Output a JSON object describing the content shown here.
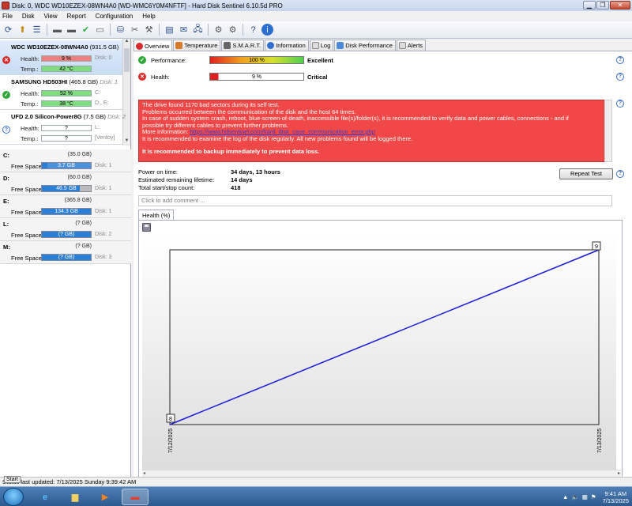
{
  "window": {
    "title": "Disk: 0, WDC WD10EZEX-08WN4A0 [WD-WMC6Y0M4NFTF]  -  Hard Disk Sentinel 6.10.5d PRO"
  },
  "menu": [
    "File",
    "Disk",
    "View",
    "Report",
    "Configuration",
    "Help"
  ],
  "toolbar_icons": [
    "refresh-icon",
    "disk-info-icon",
    "menu-icon",
    "disk-icon",
    "disk-check-icon",
    "disk-ok-icon",
    "disk-test-icon",
    "network-icon",
    "scissors-icon",
    "wrench-icon",
    "report-icon",
    "mail-icon",
    "monitor-icon",
    "gear-icon",
    "settings-icon",
    "help-icon",
    "info-icon"
  ],
  "disks": [
    {
      "name": "WDC WD10EZEX-08WN4A0",
      "size": "(931.5 GB)",
      "health_label": "Health:",
      "health": "9 %",
      "health_color": "#f08080",
      "disk_no": "Disk: 0",
      "temp_label": "Temp.:",
      "temp": "42 °C",
      "temp_color": "#7fdc7f",
      "status": "bad",
      "vols": ""
    },
    {
      "name": "SAMSUNG HD503HI",
      "size": "(465.8 GB)",
      "health_label": "Health:",
      "health": "52 %",
      "health_color": "#7fdc7f",
      "disk_no": "Disk: 1",
      "temp_label": "Temp.:",
      "temp": "38 °C",
      "temp_color": "#7fdc7f",
      "status": "good",
      "vols": "C:",
      "vols2": "D:, E:"
    },
    {
      "name": "UFD 2.0 Silicon-Power8G",
      "size": "(7.5 GB)",
      "health_label": "Health:",
      "health": "?",
      "health_color": "#ffffff",
      "disk_no": "Disk: 2",
      "temp_label": "Temp.:",
      "temp": "?",
      "temp_color": "#ffffff",
      "status": "unk",
      "vols": "L:",
      "vols2": "[Ventoy]"
    }
  ],
  "volumes": [
    {
      "letter": "C:",
      "size": "(35.0 GB)",
      "free_label": "Free Space",
      "free": "3.7 GB",
      "fill_pct": 11,
      "disk": "Disk: 1"
    },
    {
      "letter": "D:",
      "size": "(60.0 GB)",
      "free_label": "Free Space",
      "free": "46.5 GB",
      "fill_pct": 77,
      "disk": "Disk: 1"
    },
    {
      "letter": "E:",
      "size": "(365.8 GB)",
      "free_label": "Free Space",
      "free": "134.3 GB",
      "fill_pct": 37,
      "disk": "Disk: 1"
    },
    {
      "letter": "L:",
      "size": "(? GB)",
      "free_label": "Free Space",
      "free": "(? GB)",
      "fill_pct": 100,
      "disk": "Disk: 2"
    },
    {
      "letter": "M:",
      "size": "(? GB)",
      "free_label": "Free Space",
      "free": "(? GB)",
      "fill_pct": 100,
      "disk": "Disk: 3"
    }
  ],
  "tabs": [
    "Overview",
    "Temperature",
    "S.M.A.R.T.",
    "Information",
    "Log",
    "Disk Performance",
    "Alerts"
  ],
  "overview": {
    "performance_label": "Performance:",
    "performance_value": "100 %",
    "performance_pct": 100,
    "performance_verdict": "Excellent",
    "health_label": "Health:",
    "health_value": "9 %",
    "health_pct": 9,
    "health_verdict": "Critical",
    "message_lines": [
      "The drive found 1170 bad sectors during its self test.",
      "Problems occurred between the communication of the disk and the host 64 times.",
      "In case of sudden system crash, reboot, blue-screen-of-death, inaccessible file(s)/folder(s), it is recommended to verify data and power cables, connections - and if",
      "possible try different cables to prevent further problems."
    ],
    "more_info_label": "More information:",
    "more_info_link": "https://www.hdsentinel.com/hard_disk_case_communication_error.php",
    "log_line": "It is recommended to examine the log of the disk regularly. All new problems found will be logged there.",
    "backup_line": "It is recommended to backup immediately to prevent data loss.",
    "power_on_label": "Power on time:",
    "power_on_value": "34 days, 13 hours",
    "lifetime_label": "Estimated remaining lifetime:",
    "lifetime_value": "14 days",
    "startstop_label": "Total start/stop count:",
    "startstop_value": "418",
    "repeat_button": "Repeat Test",
    "comment_placeholder": "Click to add comment ...",
    "chart_tab": "Health (%)"
  },
  "chart_data": {
    "type": "line",
    "x": [
      "7/12/2025",
      "7/13/2025"
    ],
    "series": [
      {
        "values": [
          8,
          9
        ]
      }
    ],
    "data_labels": [
      "8",
      "9"
    ],
    "series_color": "#1a1ad8"
  },
  "statusbar": {
    "text": "Status last updated: 7/13/2025 Sunday 9:39:42 AM",
    "start_tooltip": "Start"
  },
  "taskbar": {
    "time": "9:41 AM",
    "date": "7/13/2025"
  }
}
